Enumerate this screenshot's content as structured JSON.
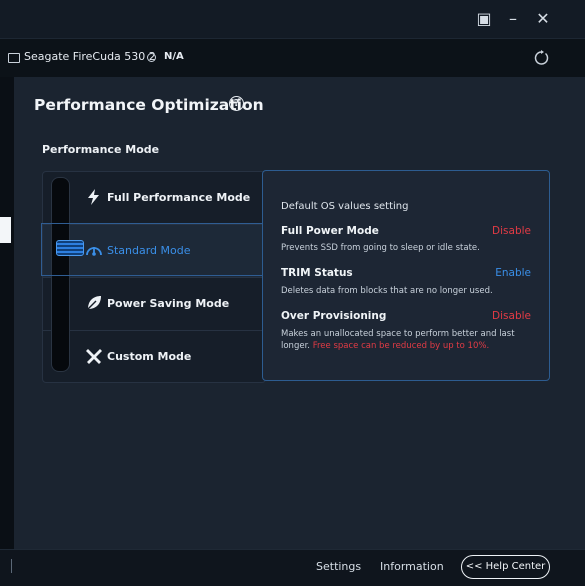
{
  "window": {
    "restore_glyph": "▣",
    "minimize_glyph": "–",
    "close_glyph": "✕"
  },
  "device": {
    "name": "Seagate FireCuda 530 2",
    "status": "N/A"
  },
  "page": {
    "title": "Performance Optimization",
    "help_glyph": "?",
    "section_title": "Performance Mode"
  },
  "modes": [
    {
      "label": "Full Performance Mode",
      "icon": "lightning-icon",
      "selected": false
    },
    {
      "label": "Standard Mode",
      "icon": "speedometer-icon",
      "selected": true
    },
    {
      "label": "Power Saving Mode",
      "icon": "leaf-icon",
      "selected": false
    },
    {
      "label": "Custom Mode",
      "icon": "tools-icon",
      "selected": false
    }
  ],
  "details": {
    "heading": "Default OS values setting",
    "items": [
      {
        "title": "Full Power Mode",
        "status": "Disable",
        "desc": "Prevents SSD from going to sleep or idle state.",
        "warning": ""
      },
      {
        "title": "TRIM Status",
        "status": "Enable",
        "desc": "Deletes data from blocks that are no longer used.",
        "warning": ""
      },
      {
        "title": "Over Provisioning",
        "status": "Disable",
        "desc": "Makes an unallocated space to perform better and last longer.",
        "warning": "Free space can be reduced by up to 10%."
      }
    ]
  },
  "footer": {
    "settings": "Settings",
    "information": "Information",
    "help_center": "<< Help Center"
  },
  "colors": {
    "accent": "#3a8fe8",
    "disable": "#e23b45",
    "enable": "#3a8fe8"
  }
}
